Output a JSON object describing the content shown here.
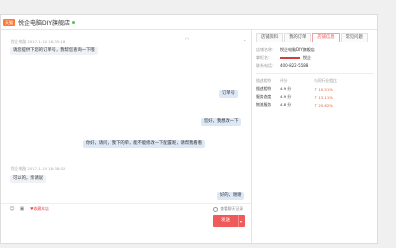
{
  "header": {
    "tag": "天猫",
    "shop_title": "悦企电脑DIY旗舰店",
    "accent": "#ff7a3a",
    "online_color": "#5ac05a"
  },
  "chat": {
    "messages": [
      {
        "side": "left",
        "meta": "悦企电脑 2017-1-10 16:35:18",
        "text": "请您提供下您的订单号，我帮您查询一下哦"
      },
      {
        "side": "right",
        "text": "订单号"
      },
      {
        "side": "right",
        "text": "您好，我想改一下"
      },
      {
        "side": "right",
        "text": "你好，请问，我下的单，能不能修改一下配置呢，请帮我看看"
      },
      {
        "side": "left",
        "meta": "悦企电脑 2017-1-10 16:38:02",
        "text": "可以的，亲请说"
      },
      {
        "side": "right",
        "text": "好的，谢谢"
      }
    ],
    "toolbar": {
      "icons": [
        "emoji-icon",
        "image-icon",
        "favorite-icon"
      ],
      "fav_label": "收藏本店",
      "history_label": "查看聊天记录"
    },
    "send_label": "发送",
    "send_color": "#ef5a5a"
  },
  "panel": {
    "tabs": [
      "店铺资料",
      "我的订单",
      "店铺信息",
      "常见问题"
    ],
    "active_tab": 2,
    "active_color": "#ee4d4d",
    "info": [
      {
        "k": "店铺名称：",
        "v": "悦企电脑DIY旗舰店"
      },
      {
        "k": "掌柜名：",
        "v": "悦企"
      },
      {
        "k": "联系电话：",
        "v": "400-822-5588"
      }
    ],
    "ratings": {
      "headers": [
        "描述相符",
        "评分",
        "与同行业相比"
      ],
      "rows": [
        {
          "label": "描述相符",
          "score": "4.9 分",
          "compare": "↑ 10.51%"
        },
        {
          "label": "服务态度",
          "score": "4.9 分",
          "compare": "↑ 13.11%"
        },
        {
          "label": "物流服务",
          "score": "4.8 分",
          "compare": "↑ 25.62%"
        }
      ]
    }
  }
}
